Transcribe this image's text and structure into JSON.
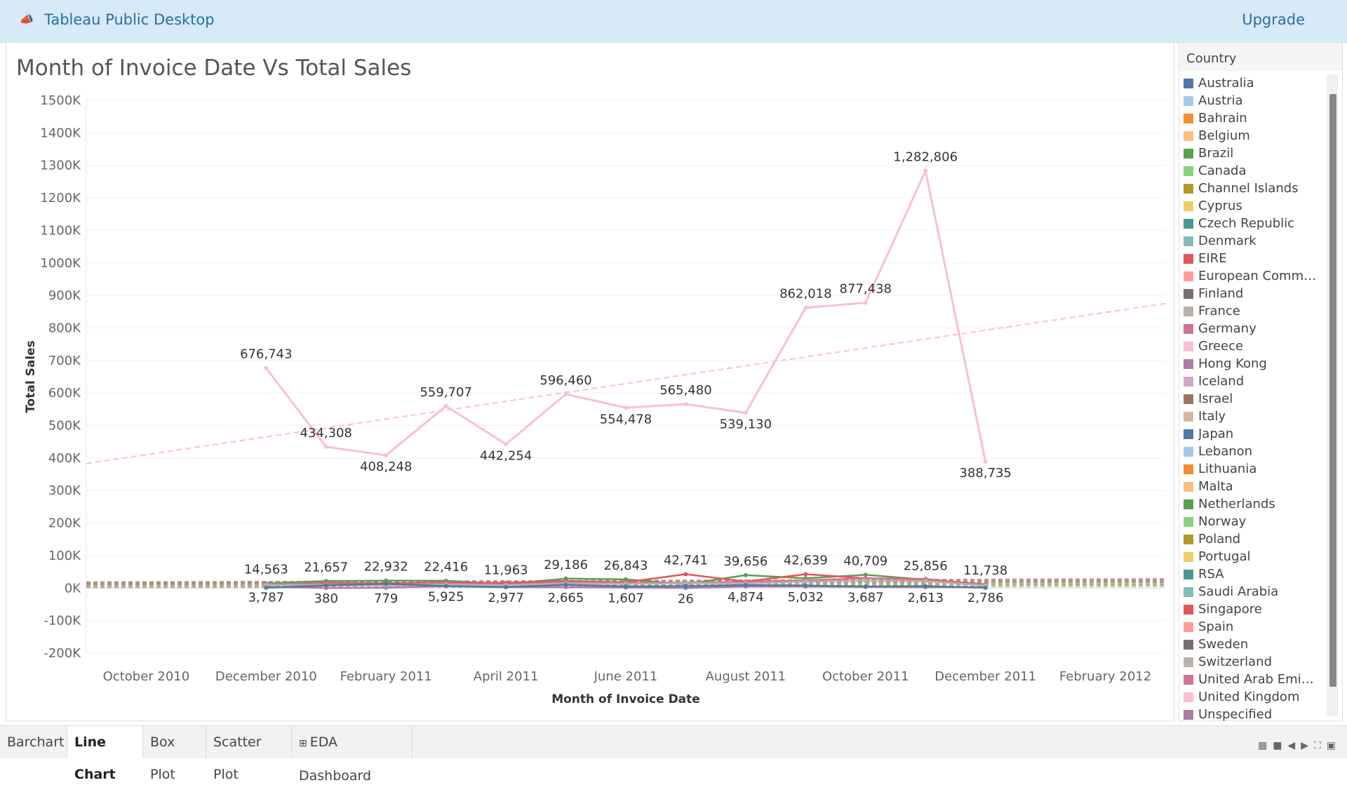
{
  "app": {
    "title": "Tableau Public Desktop",
    "upgrade_label": "Upgrade",
    "icon": "tableau-icon"
  },
  "sheet": {
    "title": "Month of Invoice Date Vs Total Sales"
  },
  "legend": {
    "title": "Country",
    "items": [
      {
        "label": "Australia",
        "color": "#4e79a7"
      },
      {
        "label": "Austria",
        "color": "#a0cbe8"
      },
      {
        "label": "Bahrain",
        "color": "#f28e2b"
      },
      {
        "label": "Belgium",
        "color": "#ffbe7d"
      },
      {
        "label": "Brazil",
        "color": "#59a14f"
      },
      {
        "label": "Canada",
        "color": "#8cd17d"
      },
      {
        "label": "Channel Islands",
        "color": "#b6992d"
      },
      {
        "label": "Cyprus",
        "color": "#f1ce63"
      },
      {
        "label": "Czech Republic",
        "color": "#499894"
      },
      {
        "label": "Denmark",
        "color": "#86bcb6"
      },
      {
        "label": "EIRE",
        "color": "#e15759"
      },
      {
        "label": "European Commun..",
        "color": "#ff9d9a"
      },
      {
        "label": "Finland",
        "color": "#79706e"
      },
      {
        "label": "France",
        "color": "#bab0ac"
      },
      {
        "label": "Germany",
        "color": "#d37295"
      },
      {
        "label": "Greece",
        "color": "#fabfd2"
      },
      {
        "label": "Hong Kong",
        "color": "#b07aa1"
      },
      {
        "label": "Iceland",
        "color": "#d4a6c8"
      },
      {
        "label": "Israel",
        "color": "#9d7660"
      },
      {
        "label": "Italy",
        "color": "#d7b5a6"
      },
      {
        "label": "Japan",
        "color": "#4e79a7"
      },
      {
        "label": "Lebanon",
        "color": "#a0cbe8"
      },
      {
        "label": "Lithuania",
        "color": "#f28e2b"
      },
      {
        "label": "Malta",
        "color": "#ffbe7d"
      },
      {
        "label": "Netherlands",
        "color": "#59a14f"
      },
      {
        "label": "Norway",
        "color": "#8cd17d"
      },
      {
        "label": "Poland",
        "color": "#b6992d"
      },
      {
        "label": "Portugal",
        "color": "#f1ce63"
      },
      {
        "label": "RSA",
        "color": "#499894"
      },
      {
        "label": "Saudi Arabia",
        "color": "#86bcb6"
      },
      {
        "label": "Singapore",
        "color": "#e15759"
      },
      {
        "label": "Spain",
        "color": "#ff9d9a"
      },
      {
        "label": "Sweden",
        "color": "#79706e"
      },
      {
        "label": "Switzerland",
        "color": "#bab0ac"
      },
      {
        "label": "United Arab Emirat..",
        "color": "#d37295"
      },
      {
        "label": "United Kingdom",
        "color": "#fabfd2"
      },
      {
        "label": "Unspecified",
        "color": "#b07aa1"
      }
    ]
  },
  "tabs": [
    {
      "label": "Barchart",
      "active": false
    },
    {
      "label": "Line Chart",
      "active": true
    },
    {
      "label": "Box Plot",
      "active": false
    },
    {
      "label": "Scatter Plot",
      "active": false
    },
    {
      "label": "EDA Dashboard",
      "active": false,
      "icon": "dashboard-grid-icon"
    }
  ],
  "chart_data": {
    "type": "line",
    "title": "Month of Invoice Date Vs Total Sales",
    "xlabel": "Month of Invoice Date",
    "ylabel": "Total Sales",
    "x_ticks": [
      "October 2010",
      "December 2010",
      "February 2011",
      "April 2011",
      "June 2011",
      "August 2011",
      "October 2011",
      "December 2011",
      "February 2012"
    ],
    "y_ticks": [
      "1500K",
      "1400K",
      "1300K",
      "1200K",
      "1100K",
      "1000K",
      "900K",
      "800K",
      "700K",
      "600K",
      "500K",
      "400K",
      "300K",
      "200K",
      "100K",
      "0K",
      "-100K",
      "-200K"
    ],
    "x_range": [
      "2010-09",
      "2012-03"
    ],
    "ylim": [
      -200000,
      1500000
    ],
    "grid": true,
    "series": [
      {
        "name": "United Kingdom",
        "color": "#fabfd2",
        "x": [
          "2010-12",
          "2011-01",
          "2011-02",
          "2011-03",
          "2011-04",
          "2011-05",
          "2011-06",
          "2011-07",
          "2011-08",
          "2011-09",
          "2011-10",
          "2011-11",
          "2011-12"
        ],
        "values": [
          676743,
          434308,
          408248,
          559707,
          442254,
          596460,
          554478,
          565480,
          539130,
          862018,
          877438,
          1282806,
          388735
        ],
        "labels": [
          "676,743",
          "434,308",
          "408,248",
          "559,707",
          "442,254",
          "596,460",
          "554,478",
          "565,480",
          "539,130",
          "862,018",
          "877,438",
          "1,282,806",
          "388,735"
        ],
        "trend": {
          "start": [
            "2010-09",
            383000
          ],
          "end": [
            "2012-03",
            875000
          ]
        }
      },
      {
        "name": "Netherlands",
        "color": "#59a14f",
        "x": [
          "2010-12",
          "2011-01",
          "2011-02",
          "2011-03",
          "2011-04",
          "2011-05",
          "2011-06",
          "2011-07",
          "2011-08",
          "2011-09",
          "2011-10",
          "2011-11",
          "2011-12"
        ],
        "values": [
          14563,
          21657,
          22932,
          22416,
          11963,
          29186,
          26843,
          12000,
          39656,
          30000,
          40709,
          25856,
          11738
        ],
        "labels": [
          "14,563",
          "21,657",
          "22,932",
          "22,416",
          "11,963",
          "29,186",
          "26,843",
          "",
          "39,656",
          "",
          "40,709",
          "25,856",
          "11,738"
        ]
      },
      {
        "name": "EIRE",
        "color": "#e15759",
        "x": [
          "2010-12",
          "2011-01",
          "2011-02",
          "2011-03",
          "2011-04",
          "2011-05",
          "2011-06",
          "2011-07",
          "2011-08",
          "2011-09",
          "2011-10",
          "2011-11",
          "2011-12"
        ],
        "values": [
          9000,
          16000,
          15000,
          17000,
          16000,
          22000,
          18000,
          42741,
          20000,
          42639,
          30000,
          28000,
          10000
        ],
        "labels": [
          "",
          "",
          "",
          "",
          "",
          "",
          "",
          "42,741",
          "",
          "42,639",
          "",
          "",
          ""
        ]
      },
      {
        "name": "Unspecified",
        "color": "#b07aa1",
        "x": [
          "2010-12",
          "2011-01",
          "2011-02",
          "2011-03",
          "2011-04",
          "2011-05",
          "2011-06",
          "2011-07",
          "2011-08",
          "2011-09",
          "2011-10",
          "2011-11",
          "2011-12"
        ],
        "values": [
          3787,
          380,
          779,
          5925,
          2977,
          2665,
          1607,
          26,
          4874,
          5032,
          3687,
          2613,
          2786
        ],
        "labels": [
          "3,787",
          "380",
          "779",
          "5,925",
          "2,977",
          "2,665",
          "1,607",
          "26",
          "4,874",
          "5,032",
          "3,687",
          "2,613",
          "2,786"
        ]
      },
      {
        "name": "Germany",
        "color": "#d37295",
        "x": [
          "2010-12",
          "2011-01",
          "2011-02",
          "2011-03",
          "2011-04",
          "2011-05",
          "2011-06",
          "2011-07",
          "2011-08",
          "2011-09",
          "2011-10",
          "2011-11",
          "2011-12"
        ],
        "values": [
          12000,
          13000,
          11000,
          14000,
          10000,
          18000,
          16000,
          17000,
          19000,
          24000,
          30000,
          26000,
          9000
        ],
        "labels": [
          "",
          "",
          "",
          "",
          "",
          "",
          "",
          "",
          "",
          "",
          "",
          "",
          ""
        ]
      },
      {
        "name": "France",
        "color": "#bab0ac",
        "x": [
          "2010-12",
          "2011-01",
          "2011-02",
          "2011-03",
          "2011-04",
          "2011-05",
          "2011-06",
          "2011-07",
          "2011-08",
          "2011-09",
          "2011-10",
          "2011-11",
          "2011-12"
        ],
        "values": [
          10000,
          9000,
          8000,
          11000,
          9000,
          14000,
          13000,
          15000,
          14000,
          20000,
          22000,
          21000,
          8000
        ],
        "labels": [
          "",
          "",
          "",
          "",
          "",
          "",
          "",
          "",
          "",
          "",
          "",
          "",
          ""
        ]
      },
      {
        "name": "Australia",
        "color": "#4e79a7",
        "x": [
          "2010-12",
          "2011-01",
          "2011-02",
          "2011-03",
          "2011-04",
          "2011-05",
          "2011-06",
          "2011-07",
          "2011-08",
          "2011-09",
          "2011-10",
          "2011-11",
          "2011-12"
        ],
        "values": [
          1000,
          8000,
          13000,
          6000,
          3000,
          10000,
          5000,
          6000,
          9000,
          8000,
          5000,
          6000,
          1000
        ],
        "labels": [
          "",
          "",
          "",
          "",
          "",
          "",
          "",
          "",
          "",
          "",
          "",
          "",
          ""
        ]
      }
    ],
    "flat_trend_colors": [
      "#4e79a7",
      "#a0cbe8",
      "#f28e2b",
      "#ffbe7d",
      "#59a14f",
      "#8cd17d",
      "#b6992d",
      "#f1ce63",
      "#499894",
      "#86bcb6",
      "#e15759",
      "#79706e",
      "#bab0ac",
      "#d37295",
      "#b07aa1",
      "#9d7660"
    ]
  }
}
